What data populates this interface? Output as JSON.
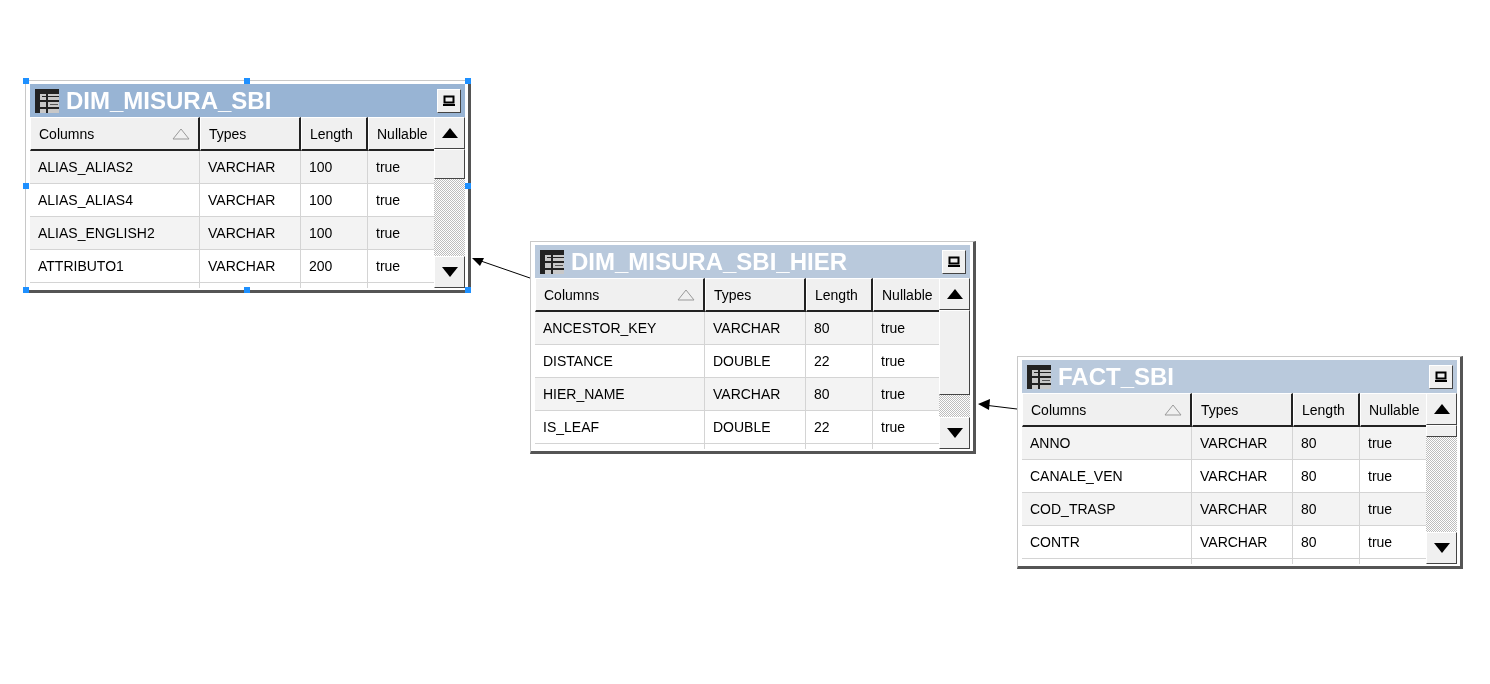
{
  "tables": [
    {
      "name": "DIM_MISURA_SBI",
      "selected": true,
      "columns": [
        "Columns",
        "Types",
        "Length",
        "Nullable"
      ],
      "rows": [
        [
          "ALIAS_ALIAS2",
          "VARCHAR",
          "100",
          "true"
        ],
        [
          "ALIAS_ALIAS4",
          "VARCHAR",
          "100",
          "true"
        ],
        [
          "ALIAS_ENGLISH2",
          "VARCHAR",
          "100",
          "true"
        ],
        [
          "ATTRIBUTO1",
          "VARCHAR",
          "200",
          "true"
        ]
      ]
    },
    {
      "name": "DIM_MISURA_SBI_HIER",
      "selected": false,
      "columns": [
        "Columns",
        "Types",
        "Length",
        "Nullable"
      ],
      "rows": [
        [
          "ANCESTOR_KEY",
          "VARCHAR",
          "80",
          "true"
        ],
        [
          "DISTANCE",
          "DOUBLE",
          "22",
          "true"
        ],
        [
          "HIER_NAME",
          "VARCHAR",
          "80",
          "true"
        ],
        [
          "IS_LEAF",
          "DOUBLE",
          "22",
          "true"
        ]
      ]
    },
    {
      "name": "FACT_SBI",
      "selected": false,
      "columns": [
        "Columns",
        "Types",
        "Length",
        "Nullable"
      ],
      "rows": [
        [
          "ANNO",
          "VARCHAR",
          "80",
          "true"
        ],
        [
          "CANALE_VEN",
          "VARCHAR",
          "80",
          "true"
        ],
        [
          "COD_TRASP",
          "VARCHAR",
          "80",
          "true"
        ],
        [
          "CONTR",
          "VARCHAR",
          "80",
          "true"
        ]
      ]
    }
  ]
}
